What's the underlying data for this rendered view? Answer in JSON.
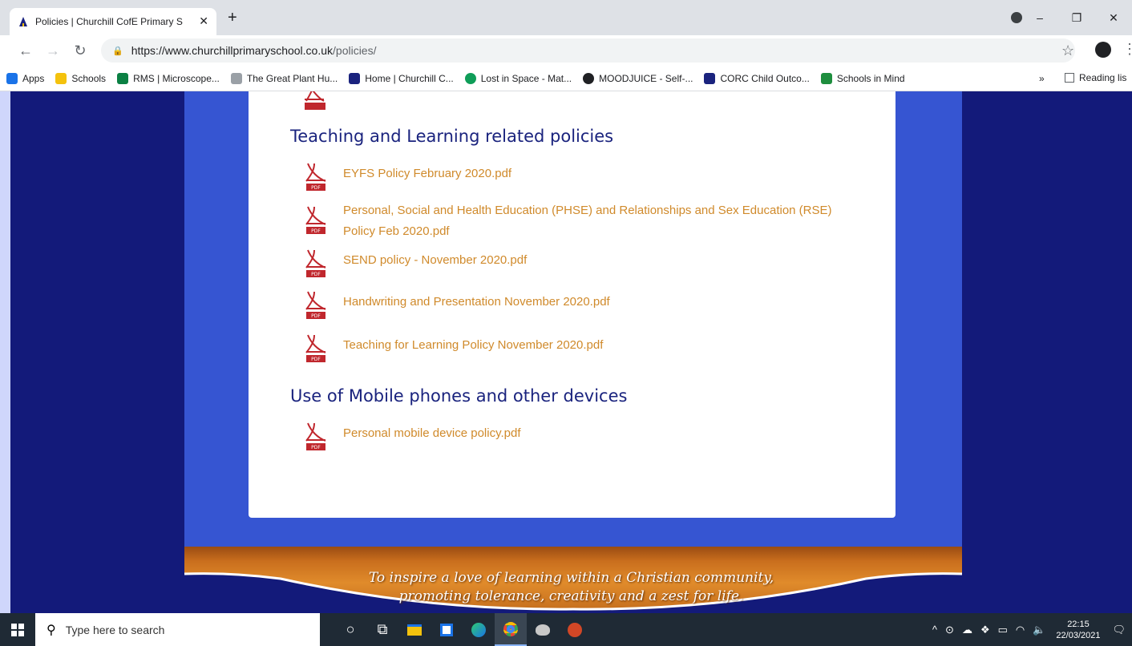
{
  "browser": {
    "tab_title": "Policies | Churchill CofE Primary S",
    "tab_close": "✕",
    "new_tab": "+",
    "url_host": "https://www.churchillprimaryschool.co.uk",
    "url_path": "/policies/",
    "window_controls": [
      "–",
      "❐",
      "✕"
    ]
  },
  "bookmarks": {
    "items": [
      {
        "label": "Apps",
        "color": "#1a73e8"
      },
      {
        "label": "Schools",
        "color": "#f4c20d"
      },
      {
        "label": "RMS | Microscope...",
        "color": "#0b8043"
      },
      {
        "label": "The Great Plant Hu...",
        "color": "#5f6368"
      },
      {
        "label": "Home | Churchill C...",
        "color": "#1a237e"
      },
      {
        "label": "Lost in Space - Mat...",
        "color": "#0f9d58"
      },
      {
        "label": "MOODJUICE - Self-...",
        "color": "#202124"
      },
      {
        "label": "CORC Child Outco...",
        "color": "#1a237e"
      },
      {
        "label": "Schools in Mind",
        "color": "#1e8e3e"
      }
    ],
    "more": "»",
    "reading_list": "Reading lis"
  },
  "page": {
    "sections": [
      {
        "heading": "Teaching and Learning related policies",
        "documents": [
          "EYFS Policy February 2020.pdf",
          "Personal, Social and Health Education (PHSE) and Relationships and Sex Education (RSE) Policy Feb 2020.pdf",
          "SEND policy - November 2020.pdf",
          "Handwriting and Presentation November 2020.pdf",
          "Teaching for Learning Policy November 2020.pdf"
        ]
      },
      {
        "heading": "Use of Mobile phones and other devices",
        "documents": [
          "Personal mobile device policy.pdf"
        ]
      }
    ],
    "motto_line1": "To inspire a love of learning within a Christian community,",
    "motto_line2": "promoting tolerance, creativity and a zest for life."
  },
  "taskbar": {
    "search_placeholder": "Type here to search",
    "time": "22:15",
    "date": "22/03/2021"
  }
}
